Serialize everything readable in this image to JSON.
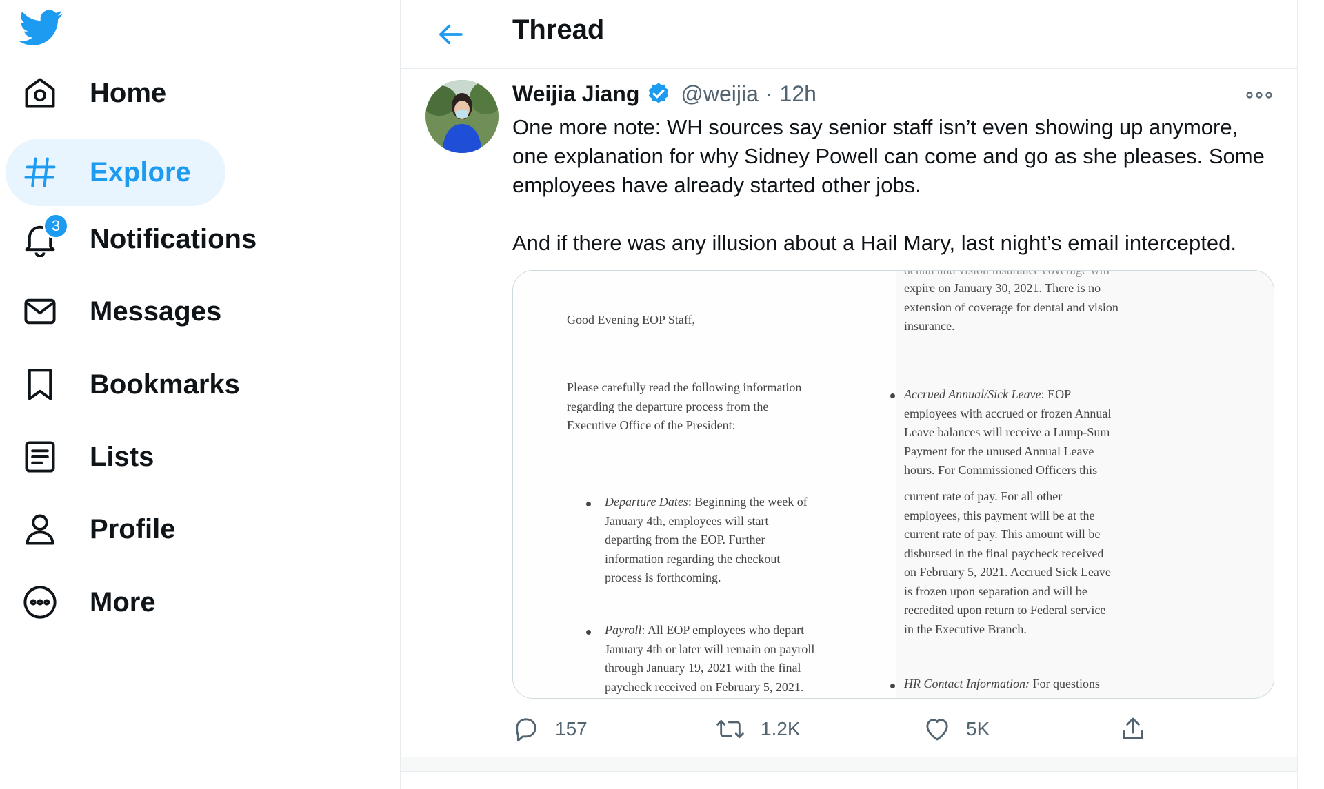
{
  "sidebar": {
    "logo": "twitter-bird-icon",
    "items": [
      {
        "label": "Home",
        "icon": "home-icon"
      },
      {
        "label": "Explore",
        "icon": "hashtag-icon",
        "active": true
      },
      {
        "label": "Notifications",
        "icon": "bell-icon",
        "badge": "3"
      },
      {
        "label": "Messages",
        "icon": "envelope-icon"
      },
      {
        "label": "Bookmarks",
        "icon": "bookmark-icon"
      },
      {
        "label": "Lists",
        "icon": "list-icon"
      },
      {
        "label": "Profile",
        "icon": "person-icon"
      },
      {
        "label": "More",
        "icon": "more-circle-icon"
      }
    ]
  },
  "header": {
    "title": "Thread",
    "back_icon": "arrow-left-icon"
  },
  "tweet": {
    "author_name": "Weijia Jiang",
    "handle": "@weijia",
    "separator": "·",
    "time": "12h",
    "text_p1": "One more note: WH sources say senior staff isn’t even showing up anymore, one explanation for why Sidney Powell can come and go as she pleases. Some employees have already started other jobs.",
    "text_p2": "And if there was any illusion about a Hail Mary, last night’s email intercepted.",
    "media": {
      "left": {
        "greeting": "Good Evening EOP Staff,",
        "intro": "Please carefully read the following information\nregarding the departure process from the\nExecutive Office of the President:",
        "b1_title": "Departure Dates",
        "b1_text": ": Beginning the week of\nJanuary 4th, employees will start\ndeparting from the EOP. Further\ninformation regarding the checkout\nprocess is forthcoming.",
        "b2_title": "Payroll",
        "b2_text": ": All EOP employees who depart\nJanuary 4th or later will remain on payroll\nthrough January 19, 2021 with the final\npaycheck received on February 5, 2021."
      },
      "right": {
        "top_cut": "dental and vision insurance coverage will",
        "top": "expire on January 30, 2021. There is no\nextension of coverage for dental and vision\ninsurance.",
        "b1_title": "Accrued Annual/Sick Leave",
        "b1_text": ": EOP\nemployees with accrued or frozen Annual\nLeave balances will receive a Lump-Sum\nPayment for the unused Annual Leave\nhours. For Commissioned Officers this",
        "mid": "current rate of pay. For all other\nemployees, this payment will be at the\ncurrent rate of pay. This amount will be\ndisbursed in the final paycheck received\non February 5, 2021. Accrued Sick Leave\nis frozen upon separation and will be\nrecredited upon return to Federal service\nin the Executive Branch.",
        "b2_title": "HR Contact Information:",
        "b2_text": " For questions"
      }
    },
    "actions": {
      "replies": "157",
      "retweets": "1.2K",
      "likes": "5K"
    }
  },
  "colors": {
    "accent": "#1d9bf0",
    "text": "#0f1419",
    "muted": "#536471",
    "active_bg": "#e8f5fe"
  }
}
